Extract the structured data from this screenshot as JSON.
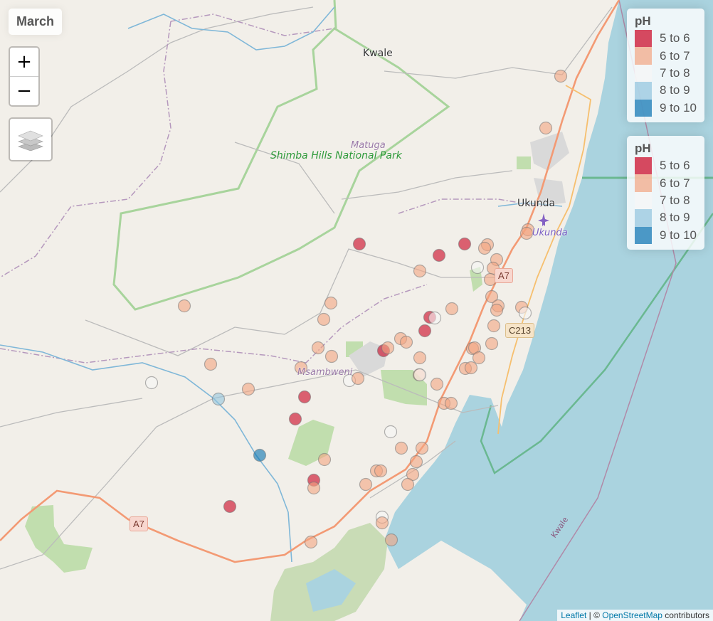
{
  "map": {
    "title": "March",
    "controls": {
      "zoom_in": "+",
      "zoom_out": "−",
      "layers_icon": "layers-icon"
    },
    "places": [
      {
        "name": "Kwale",
        "kind": "town"
      },
      {
        "name": "Ukunda",
        "kind": "town"
      },
      {
        "name": "Matuga",
        "kind": "village"
      },
      {
        "name": "Msambweni",
        "kind": "village"
      },
      {
        "name": "Ukunda",
        "kind": "village"
      },
      {
        "name": "Shimba Hills National Park",
        "kind": "park"
      }
    ],
    "road_shields": [
      "A7",
      "A7",
      "C213"
    ],
    "sea_label": "Kwale",
    "attribution": {
      "leaflet": "Leaflet",
      "separator": " | © ",
      "osm": "OpenStreetMap",
      "suffix": " contributors"
    }
  },
  "legends": [
    {
      "title": "pH",
      "items": [
        {
          "label": "5 to 6",
          "color": "#ca0020"
        },
        {
          "label": "6 to 7",
          "color": "#f4a582"
        },
        {
          "label": "7 to 8",
          "color": "#f7f7f7"
        },
        {
          "label": "8 to 9",
          "color": "#92c5de"
        },
        {
          "label": "9 to 10",
          "color": "#0571b0"
        }
      ]
    },
    {
      "title": "pH",
      "items": [
        {
          "label": "5 to 6",
          "color": "#ca0020"
        },
        {
          "label": "6 to 7",
          "color": "#f4a582"
        },
        {
          "label": "7 to 8",
          "color": "#f7f7f7"
        },
        {
          "label": "8 to 9",
          "color": "#92c5de"
        },
        {
          "label": "9 to 10",
          "color": "#0571b0"
        }
      ]
    }
  ],
  "markers_ph_class": {
    "5 to 6": 11,
    "6 to 7": 63,
    "7 to 8": 9,
    "8 to 9": 1,
    "9 to 10": 1
  }
}
